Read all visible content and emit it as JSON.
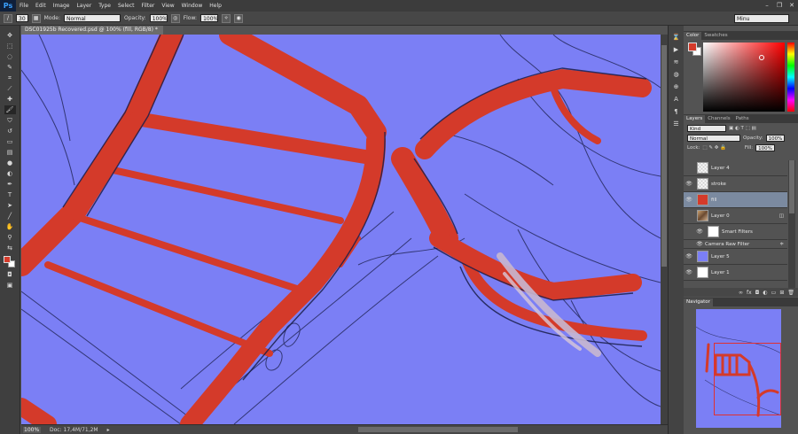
{
  "app": {
    "logo": "Ps"
  },
  "menu": [
    "File",
    "Edit",
    "Image",
    "Layer",
    "Type",
    "Select",
    "Filter",
    "View",
    "Window",
    "Help"
  ],
  "window_controls": {
    "minimize": "–",
    "restore": "❐",
    "close": "✕"
  },
  "options_bar": {
    "brush_size": "30",
    "mode_label": "Mode:",
    "mode_value": "Normal",
    "opacity_label": "Opacity:",
    "opacity_value": "100%",
    "flow_label": "Flow:",
    "flow_value": "100%",
    "workspace": "Minu"
  },
  "document": {
    "tab_title": "DSC01925b Recovered.psd @ 100% (fill, RGB/8) *",
    "close": "×",
    "zoom": "100%",
    "doc_info": "Doc: 17,4M/71,2M"
  },
  "color_panel": {
    "tabs": [
      "Color",
      "Swatches"
    ],
    "foreground": "#d43a2a",
    "background": "#ffffff"
  },
  "layers_panel": {
    "tabs": [
      "Layers",
      "Channels",
      "Paths"
    ],
    "filter_kind": "Kind",
    "blend_mode": "Normal",
    "opacity_label": "Opacity:",
    "opacity_value": "100%",
    "lock_label": "Lock:",
    "fill_label": "Fill:",
    "fill_value": "100%",
    "layers": [
      {
        "name": "Layer 4",
        "visible": false,
        "thumb": "trans"
      },
      {
        "name": "stroke",
        "visible": true,
        "thumb": "trans"
      },
      {
        "name": "fill",
        "visible": true,
        "thumb": "fill",
        "selected": true
      },
      {
        "name": "Layer 0",
        "visible": false,
        "thumb": "photo"
      },
      {
        "name": "Smart Filters",
        "visible": true,
        "thumb": "white"
      },
      {
        "name": "Camera Raw Filter",
        "visible": true,
        "thumb": "none"
      },
      {
        "name": "Layer 5",
        "visible": true,
        "thumb": "blue"
      },
      {
        "name": "Layer 1",
        "visible": true,
        "thumb": "white"
      }
    ]
  },
  "navigator_panel": {
    "tab": "Navigator"
  },
  "colors": {
    "canvas": "#7b7ff5",
    "paint_red": "#d43a2a",
    "line_dark": "#1a1e4a"
  }
}
